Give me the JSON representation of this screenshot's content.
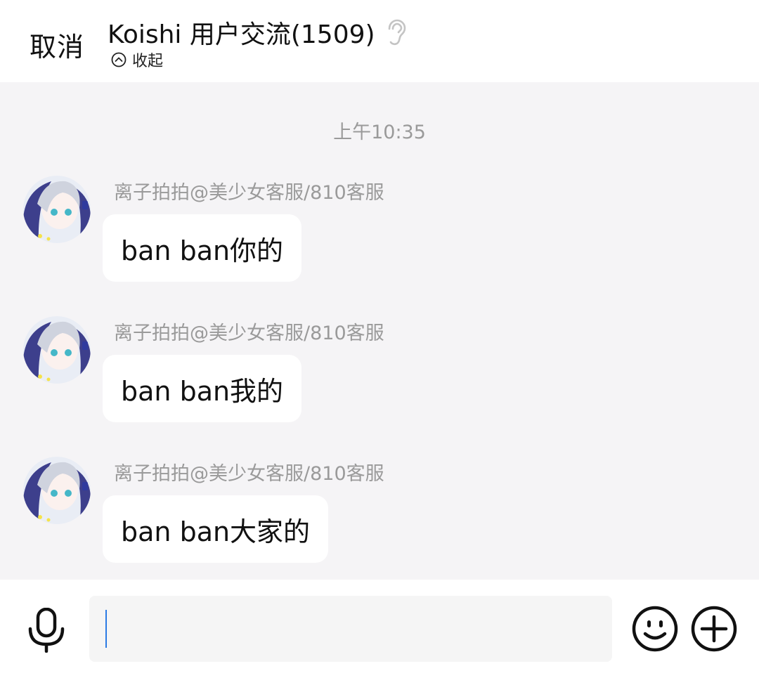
{
  "header": {
    "cancel_label": "取消",
    "title": "Koishi 用户交流(1509)",
    "collapse_label": "收起"
  },
  "chat": {
    "timestamp": "上午10:35",
    "messages": [
      {
        "sender": "离子拍拍@美少女客服/810客服",
        "text": "ban ban你的"
      },
      {
        "sender": "离子拍拍@美少女客服/810客服",
        "text": "ban ban我的"
      },
      {
        "sender": "离子拍拍@美少女客服/810客服",
        "text": "ban ban大家的"
      }
    ]
  },
  "input": {
    "placeholder": ""
  },
  "icons": {
    "mic": "microphone-icon",
    "emoji": "smiley-icon",
    "plus": "plus-circle-icon",
    "ear": "ear-icon",
    "collapse": "chevron-up-circle-icon"
  },
  "colors": {
    "background": "#f5f4f6",
    "bubble": "#ffffff",
    "caret": "#2b7be4",
    "muted_text": "#9a9a9a"
  }
}
